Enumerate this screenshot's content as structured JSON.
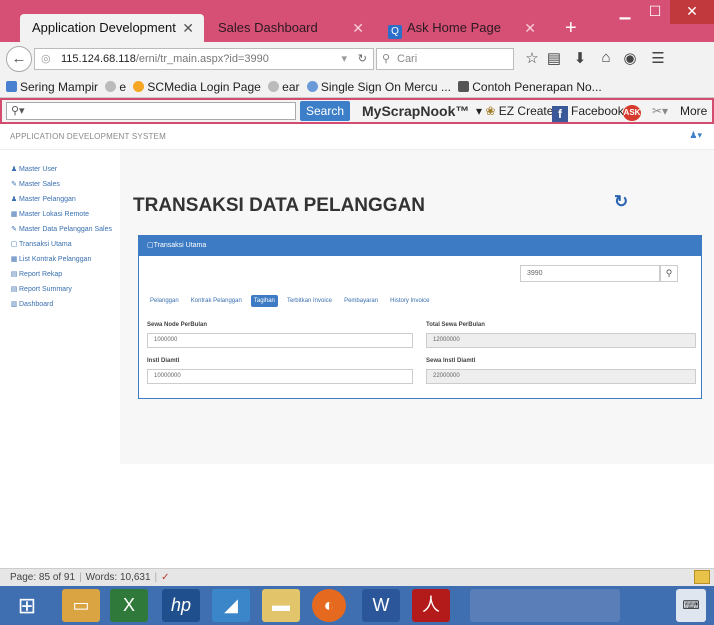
{
  "browser": {
    "tabs": [
      {
        "title": "Application Development",
        "active": true
      },
      {
        "title": "Sales Dashboard",
        "active": false
      },
      {
        "title": "Ask Home Page",
        "active": false
      }
    ],
    "url_host": "115.124.68.118",
    "url_path": "/erni/tr_main.aspx?id=3990",
    "search_placeholder": "Cari",
    "bookmarks": [
      "Sering Mampir",
      "e",
      "SCMedia Login Page",
      "ear",
      "Single Sign On Mercu ...",
      "Contoh Penerapan No..."
    ],
    "toolbar": {
      "search_button": "Search",
      "brand": "MyScrapNook™",
      "ez_create": "EZ Create",
      "facebook": "Facebook",
      "more": "More"
    }
  },
  "app": {
    "system_name": "APPLICATION DEVELOPMENT SYSTEM",
    "sidebar": [
      {
        "label": "Master User",
        "icon": "user-icon"
      },
      {
        "label": "Master Sales",
        "icon": "edit-icon"
      },
      {
        "label": "Master Pelanggan",
        "icon": "people-icon"
      },
      {
        "label": "Master Lokasi Remote",
        "icon": "list-icon"
      },
      {
        "label": "Master Data Pelanggan Sales",
        "icon": "edit-icon"
      },
      {
        "label": "Transaksi Utama",
        "icon": "document-icon"
      },
      {
        "label": "List Kontrak Pelanggan",
        "icon": "list-icon"
      },
      {
        "label": "Report Rekap",
        "icon": "table-icon"
      },
      {
        "label": "Report Summary",
        "icon": "table-icon"
      },
      {
        "label": "Dashboard",
        "icon": "chart-icon"
      }
    ],
    "page_title": "TRANSAKSI DATA PELANGGAN",
    "panel": {
      "title": "Transaksi Utama",
      "code_value": "3990",
      "tabs": [
        "Pelanggan",
        "Kontrak Pelanggan",
        "Tagihan",
        "Terbitkan Invoice",
        "Pembayaran",
        "History Invoice"
      ],
      "active_tab": "Tagihan",
      "fields": {
        "sewa_node_label": "Sewa Node PerBulan",
        "sewa_node_value": "1000000",
        "total_sewa_label": "Total Sewa PerBulan",
        "total_sewa_value": "12000000",
        "instl_label": "Instl Diamtl",
        "instl_value": "10000000",
        "sewa_instl_label": "Sewa Instl Diamtl",
        "sewa_instl_value": "22000000"
      }
    }
  },
  "statusbar": {
    "page": "Page: 85 of 91",
    "words": "Words: 10,631"
  },
  "colors": {
    "browser_frame": "#d64f74",
    "accent_blue": "#3d7cc4",
    "link_blue": "#3a6fb0"
  }
}
